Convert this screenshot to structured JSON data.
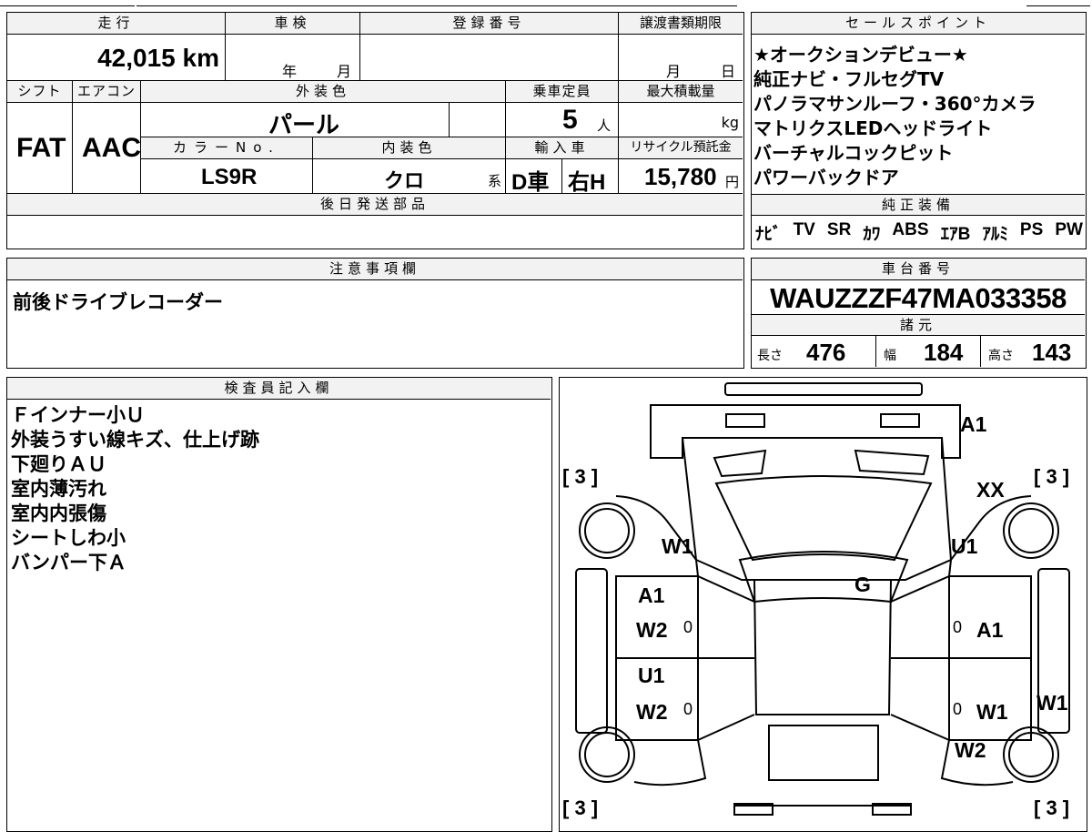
{
  "vehicle": {
    "mileage_label": "走行",
    "mileage_value": "42,015 km",
    "inspection_label": "車検",
    "inspection_year": "年",
    "inspection_month": "月",
    "registration_label": "登録番号",
    "transfer_label": "譲渡書類期限",
    "transfer_month": "月",
    "transfer_day": "日",
    "shift_label": "シフト",
    "shift_value": "FAT",
    "aircon_label": "エアコン",
    "aircon_value": "AAC",
    "exterior_color_label": "外装色",
    "exterior_color_value": "パール",
    "capacity_label": "乗車定員",
    "capacity_value": "5",
    "capacity_unit": "人",
    "max_load_label": "最大積載量",
    "max_load_unit": "kg",
    "color_no_label": "カラーNo.",
    "color_no_value": "LS9R",
    "interior_label": "内装色",
    "interior_value": "クロ",
    "interior_suffix": "系",
    "import_label": "輸入車",
    "import_value": "D車",
    "steering_value": "右H",
    "recycle_label": "リサイクル預託金",
    "recycle_value": "15,780",
    "recycle_unit": "円",
    "later_parts_label": "後日発送部品"
  },
  "sales_points": {
    "title": "セールスポイント",
    "items": [
      "★オークションデビュー★",
      "純正ナビ・フルセグTV",
      "パノラマサンルーフ・360°カメラ",
      "マトリクスLEDヘッドライト",
      "バーチャルコックピット",
      "パワーバックドア"
    ]
  },
  "equipment": {
    "title": "純正装備",
    "items": [
      "ﾅﾋﾞ",
      "TV",
      "SR",
      "ｶﾜ",
      "ABS",
      "ｴｱB",
      "ｱﾙﾐ",
      "PS",
      "PW"
    ]
  },
  "notes": {
    "title": "注意事項欄",
    "text": "前後ドライブレコーダー"
  },
  "chassis": {
    "title": "車台番号",
    "value": "WAUZZZF47MA033358",
    "spec_title": "諸元",
    "length_label": "長さ",
    "length_value": "476",
    "width_label": "幅",
    "width_value": "184",
    "height_label": "高さ",
    "height_value": "143"
  },
  "inspector": {
    "title": "検査員記入欄",
    "lines": [
      "Ｆインナー小Ｕ",
      "外装うすい線キズ、仕上げ跡",
      "下廻りＡＵ",
      "室内薄汚れ",
      "室内内張傷",
      "シートしわ小",
      "バンパー下Ａ"
    ]
  },
  "diagram": {
    "bracket_tl": "[ 3 ]",
    "bracket_tr": "[ 3 ]",
    "bracket_bl": "[ 3 ]",
    "bracket_br": "[ 3 ]",
    "front_bumper": "A1",
    "hood": "XX",
    "left_front_fender": "W1",
    "right_front_fender": "U1",
    "windshield": "G",
    "left_front_door_1": "A1",
    "left_front_door_2": "W2",
    "left_rear_door_1": "U1",
    "left_rear_door_2": "W2",
    "right_front_door": "A1",
    "right_rear_door": "W1",
    "right_side_sill": "W1",
    "right_rear_fender": "W2",
    "zero_1": "0",
    "zero_2": "0",
    "zero_3": "0",
    "zero_4": "0"
  }
}
